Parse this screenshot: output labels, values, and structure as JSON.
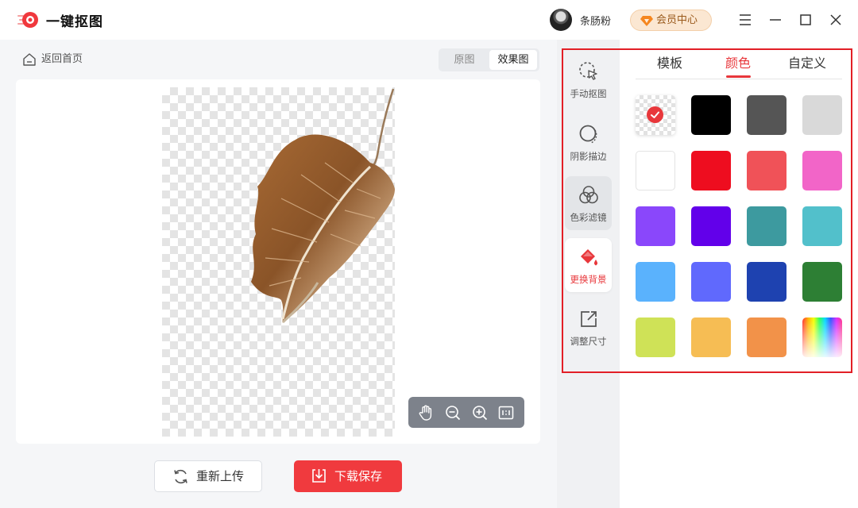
{
  "app": {
    "title": "一键抠图"
  },
  "user": {
    "name": "条肠粉",
    "vip_label": "会员中心"
  },
  "nav": {
    "back_label": "返回首页"
  },
  "view_toggle": {
    "original": "原图",
    "effect": "效果图",
    "selected": "效果图"
  },
  "actions": {
    "reupload_label": "重新上传",
    "download_label": "下载保存"
  },
  "tools": [
    {
      "label": "手动抠图",
      "icon": "cursor-select-icon"
    },
    {
      "label": "阴影描边",
      "icon": "shadow-outline-icon"
    },
    {
      "label": "色彩滤镜",
      "icon": "color-filter-icon"
    },
    {
      "label": "更换背景",
      "icon": "paint-bucket-icon",
      "active": true
    },
    {
      "label": "调整尺寸",
      "icon": "resize-icon"
    }
  ],
  "bg_tabs": {
    "template": "模板",
    "color": "颜色",
    "custom": "自定义",
    "selected": "颜色"
  },
  "swatches": [
    {
      "color": "transparent",
      "selected": true
    },
    {
      "color": "#000000"
    },
    {
      "color": "#555555"
    },
    {
      "color": "#d9d9d9"
    },
    {
      "color": "#ffffff"
    },
    {
      "color": "#ee0d1f"
    },
    {
      "color": "#f05258"
    },
    {
      "color": "#f265c8"
    },
    {
      "color": "#8a47fb"
    },
    {
      "color": "#6200ea"
    },
    {
      "color": "#3d9a9f"
    },
    {
      "color": "#52c0cb"
    },
    {
      "color": "#5ab2fd"
    },
    {
      "color": "#6069fd"
    },
    {
      "color": "#1e42b0"
    },
    {
      "color": "#2d7f34"
    },
    {
      "color": "#cfe257"
    },
    {
      "color": "#f6bd54"
    },
    {
      "color": "#f29249"
    },
    {
      "color": "rainbow"
    }
  ],
  "colors": {
    "accent": "#e8373b",
    "primary_button": "#f03a3e"
  }
}
